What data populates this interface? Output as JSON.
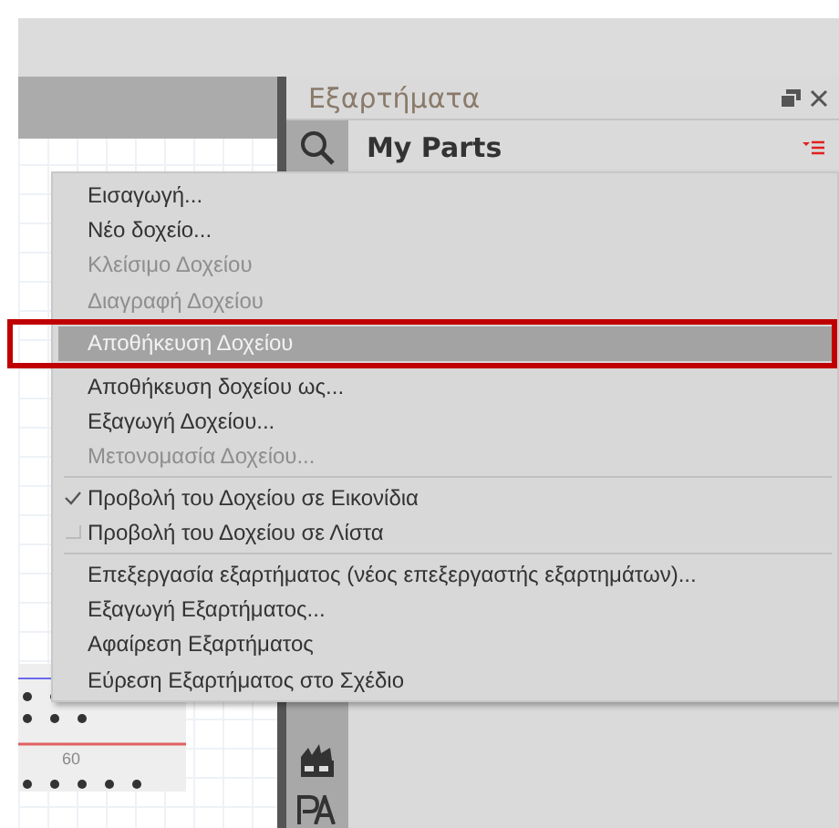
{
  "parts_panel": {
    "title": "Εξαρτήματα",
    "bin_title": "My Parts"
  },
  "canvas": {
    "ruler_label": "60"
  },
  "menu": {
    "items": [
      {
        "kind": "action",
        "label": "Εισαγωγή...",
        "disabled": false,
        "selected": false
      },
      {
        "kind": "action",
        "label": "Νέο δοχείο...",
        "disabled": false,
        "selected": false
      },
      {
        "kind": "action",
        "label": "Κλείσιμο Δοχείου",
        "disabled": true,
        "selected": false
      },
      {
        "kind": "action",
        "label": "Διαγραφή Δοχείου",
        "disabled": true,
        "selected": false
      },
      {
        "kind": "action",
        "label": "Αποθήκευση Δοχείου",
        "disabled": false,
        "selected": true
      },
      {
        "kind": "action",
        "label": "Αποθήκευση δοχείου ως...",
        "disabled": false,
        "selected": false
      },
      {
        "kind": "action",
        "label": "Εξαγωγή Δοχείου...",
        "disabled": false,
        "selected": false
      },
      {
        "kind": "action",
        "label": "Μετονομασία Δοχείου...",
        "disabled": true,
        "selected": false
      },
      {
        "kind": "separator"
      },
      {
        "kind": "toggle",
        "label": "Προβολή του Δοχείου σε Εικονίδια",
        "checked": true,
        "selected": false
      },
      {
        "kind": "toggle",
        "label": "Προβολή του Δοχείου σε Λίστα",
        "checked": false,
        "selected": false
      },
      {
        "kind": "separator"
      },
      {
        "kind": "action",
        "label": "Επεξεργασία εξαρτήματος (νέος επεξεργαστής εξαρτημάτων)...",
        "disabled": false,
        "selected": false
      },
      {
        "kind": "action",
        "label": "Εξαγωγή Εξαρτήματος...",
        "disabled": false,
        "selected": false
      },
      {
        "kind": "action",
        "label": "Αφαίρεση Εξαρτήματος",
        "disabled": false,
        "selected": false
      },
      {
        "kind": "action",
        "label": "Εύρεση Εξαρτήματος στο Σχέδιο",
        "disabled": false,
        "selected": false
      }
    ]
  }
}
